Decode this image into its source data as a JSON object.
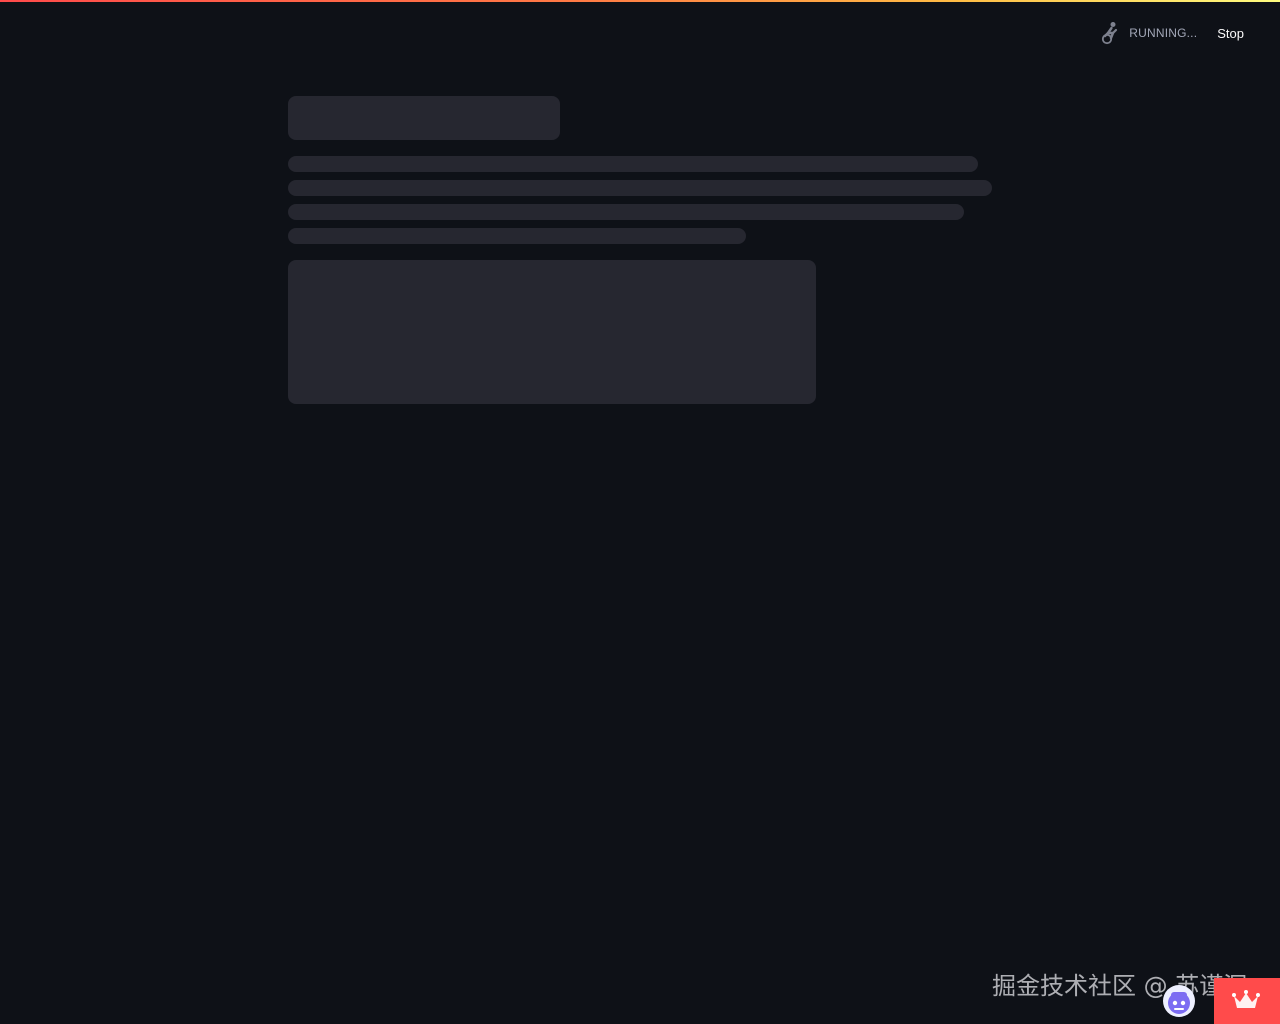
{
  "app": {
    "status": {
      "icon": "running-person-icon",
      "label": "RUNNING...",
      "stop_label": "Stop"
    }
  },
  "watermark": {
    "text": "掘金技术社区 @ 苏谨深"
  },
  "colors": {
    "background": "#0e1117",
    "skeleton": "#262730",
    "accent": "#ff4b4b",
    "status_text": "#a3a8b8",
    "avatar": "#7c6cf2"
  },
  "icons": {
    "status": "running-person-icon",
    "avatar": "bot-avatar-icon",
    "badge": "crown-icon"
  }
}
